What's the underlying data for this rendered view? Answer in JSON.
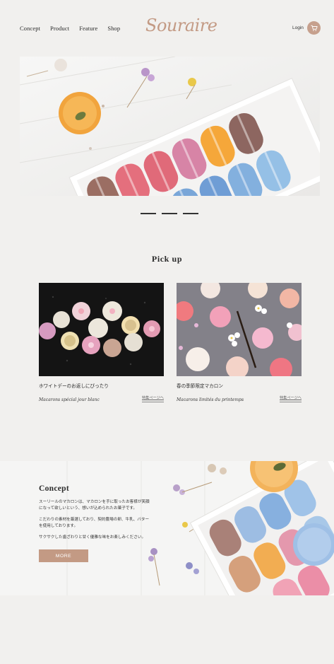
{
  "header": {
    "nav": [
      "Concept",
      "Product",
      "Feature",
      "Shop"
    ],
    "logo": "Souraire",
    "login": "Login"
  },
  "hero": {
    "slide_count": 3
  },
  "pickup": {
    "title": "Pick up",
    "cards": [
      {
        "title": "ホワイトデーのお返しにぴったり",
        "script": "Macarons spécial jour blanc",
        "link": "特集ページへ"
      },
      {
        "title": "春の季節限定マカロン",
        "script": "Macarons limités du printemps",
        "link": "特集ページへ"
      }
    ]
  },
  "concept": {
    "title": "Concept",
    "paragraphs": [
      "スーリールのマカロンは、マカロンを手に取ったお客様が笑顔になって欲しいという、想いが込められたお菓子です。",
      "こだわりの素材を厳選しており、契約農場の卵、牛乳、バターを使用しております。",
      "サクサクした歯ざわりと甘く優雅な味をお楽しみください。"
    ],
    "button": "MORE"
  },
  "colors": {
    "accent": "#c39a84",
    "background": "#f1f0ee"
  }
}
